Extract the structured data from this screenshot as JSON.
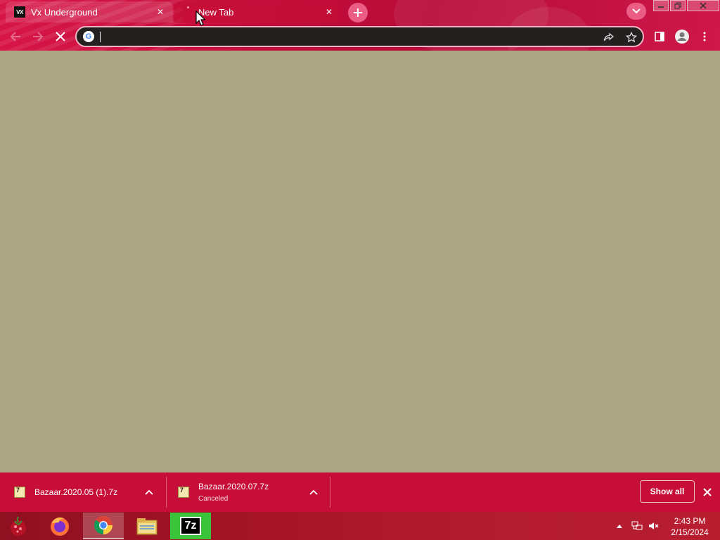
{
  "browser": {
    "tabs": [
      {
        "title": "Vx Underground",
        "favicon_text": "VX",
        "active": false
      },
      {
        "title": "New Tab",
        "active": true,
        "loading": true
      }
    ],
    "omnibox": {
      "value": "",
      "placeholder": ""
    }
  },
  "downloads": {
    "items": [
      {
        "filename": "Bazaar.2020.05 (1).7z",
        "status": ""
      },
      {
        "filename": "Bazaar.2020.07.7z",
        "status": "Canceled"
      }
    ],
    "show_all_label": "Show all"
  },
  "taskbar": {
    "apps": [
      "firefox",
      "chrome",
      "file-explorer",
      "7-zip"
    ],
    "seven_zip_label": "7z",
    "clock_time": "2:43 PM",
    "clock_date": "2/15/2024"
  },
  "colors": {
    "accent": "#c70e38",
    "content_bg": "#aca583",
    "omnibox_bg": "#23201f"
  }
}
